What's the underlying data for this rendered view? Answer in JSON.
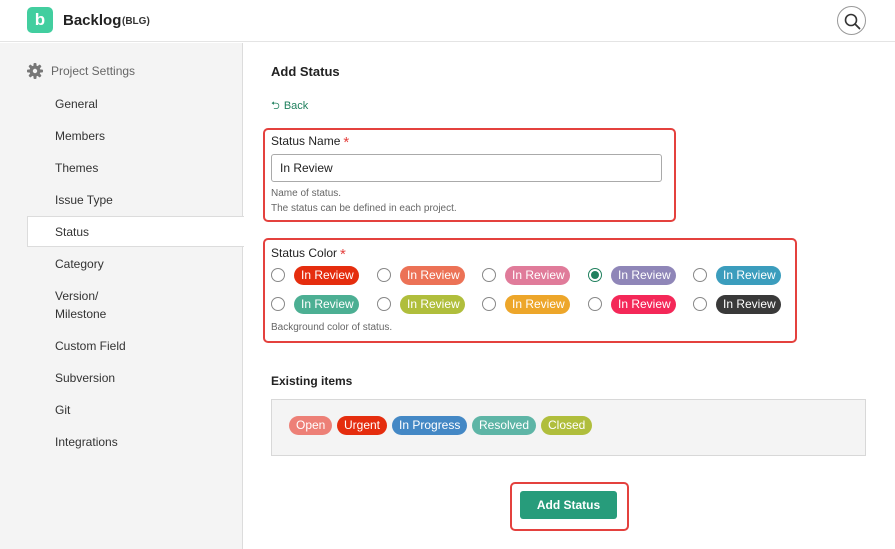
{
  "header": {
    "logo_letter": "b",
    "app_name": "Backlog",
    "project_key": "(BLG)"
  },
  "sidebar": {
    "heading": "Project Settings",
    "items": [
      {
        "label": "General"
      },
      {
        "label": "Members"
      },
      {
        "label": "Themes"
      },
      {
        "label": "Issue Type"
      },
      {
        "label": "Status",
        "active": true
      },
      {
        "label": "Category"
      },
      {
        "label": "Version/"
      },
      {
        "label": "Milestone"
      },
      {
        "label": "Custom Field"
      },
      {
        "label": "Subversion"
      },
      {
        "label": "Git"
      },
      {
        "label": "Integrations"
      }
    ]
  },
  "main": {
    "title": "Add Status",
    "back_label": "Back",
    "status_name": {
      "label": "Status Name",
      "required_mark": "*",
      "value": "In Review",
      "hint_line1": "Name of status.",
      "hint_line2": "The status can be defined in each project."
    },
    "status_color": {
      "label": "Status Color",
      "required_mark": "*",
      "pill_text": "In Review",
      "options": [
        {
          "color": "#e52d0e",
          "selected": false
        },
        {
          "color": "#ec7256",
          "selected": false
        },
        {
          "color": "#e07b9a",
          "selected": false
        },
        {
          "color": "#8f86b8",
          "selected": true
        },
        {
          "color": "#3b9dbd",
          "selected": false
        },
        {
          "color": "#4caf93",
          "selected": false
        },
        {
          "color": "#b0be3c",
          "selected": false
        },
        {
          "color": "#eda62a",
          "selected": false
        },
        {
          "color": "#f42858",
          "selected": false
        },
        {
          "color": "#393939",
          "selected": false
        }
      ],
      "hint": "Background color of status."
    },
    "existing": {
      "title": "Existing items",
      "items": [
        {
          "label": "Open",
          "color": "#ed8077"
        },
        {
          "label": "Urgent",
          "color": "#e52d0e"
        },
        {
          "label": "In Progress",
          "color": "#4488c5"
        },
        {
          "label": "Resolved",
          "color": "#5eb5a6"
        },
        {
          "label": "Closed",
          "color": "#b0be3c"
        }
      ]
    },
    "submit_label": "Add Status"
  }
}
